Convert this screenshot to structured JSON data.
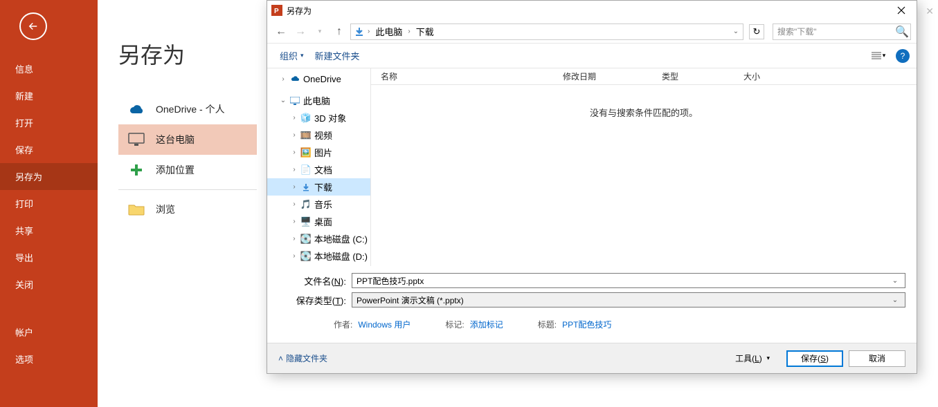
{
  "backstage": {
    "title": "另存为",
    "items": [
      "信息",
      "新建",
      "打开",
      "保存",
      "另存为",
      "打印",
      "共享",
      "导出",
      "关闭"
    ],
    "activeIndex": 4,
    "bottomItems": [
      "帐户",
      "选项"
    ]
  },
  "locations": {
    "onedrive": {
      "label": "OneDrive - 个人",
      "sub": ""
    },
    "thispc": {
      "label": "这台电脑"
    },
    "addplace": {
      "label": "添加位置"
    },
    "browse": {
      "label": "浏览"
    }
  },
  "dialog": {
    "title": "另存为",
    "breadcrumb": {
      "root": "此电脑",
      "folder": "下载"
    },
    "searchPlaceholder": "搜索\"下载\"",
    "toolbar": {
      "organize": "组织",
      "newfolder": "新建文件夹"
    },
    "headers": {
      "name": "名称",
      "date": "修改日期",
      "type": "类型",
      "size": "大小"
    },
    "emptyMsg": "没有与搜索条件匹配的项。",
    "tree": {
      "onedrive": "OneDrive",
      "thispc": "此电脑",
      "items": [
        "3D 对象",
        "视频",
        "图片",
        "文档",
        "下载",
        "音乐",
        "桌面",
        "本地磁盘 (C:)",
        "本地磁盘 (D:)"
      ],
      "selected": "下载"
    },
    "fields": {
      "filenameLabel": "文件名(N):",
      "filename": "PPT配色技巧.pptx",
      "typeLabel": "保存类型(T):",
      "type": "PowerPoint 演示文稿 (*.pptx)"
    },
    "meta": {
      "authorLbl": "作者:",
      "author": "Windows 用户",
      "tagLbl": "标记:",
      "tag": "添加标记",
      "titleLbl": "标题:",
      "title": "PPT配色技巧"
    },
    "footer": {
      "hideFolders": "隐藏文件夹",
      "tools": "工具(L)",
      "save": "保存(S)",
      "cancel": "取消"
    }
  }
}
